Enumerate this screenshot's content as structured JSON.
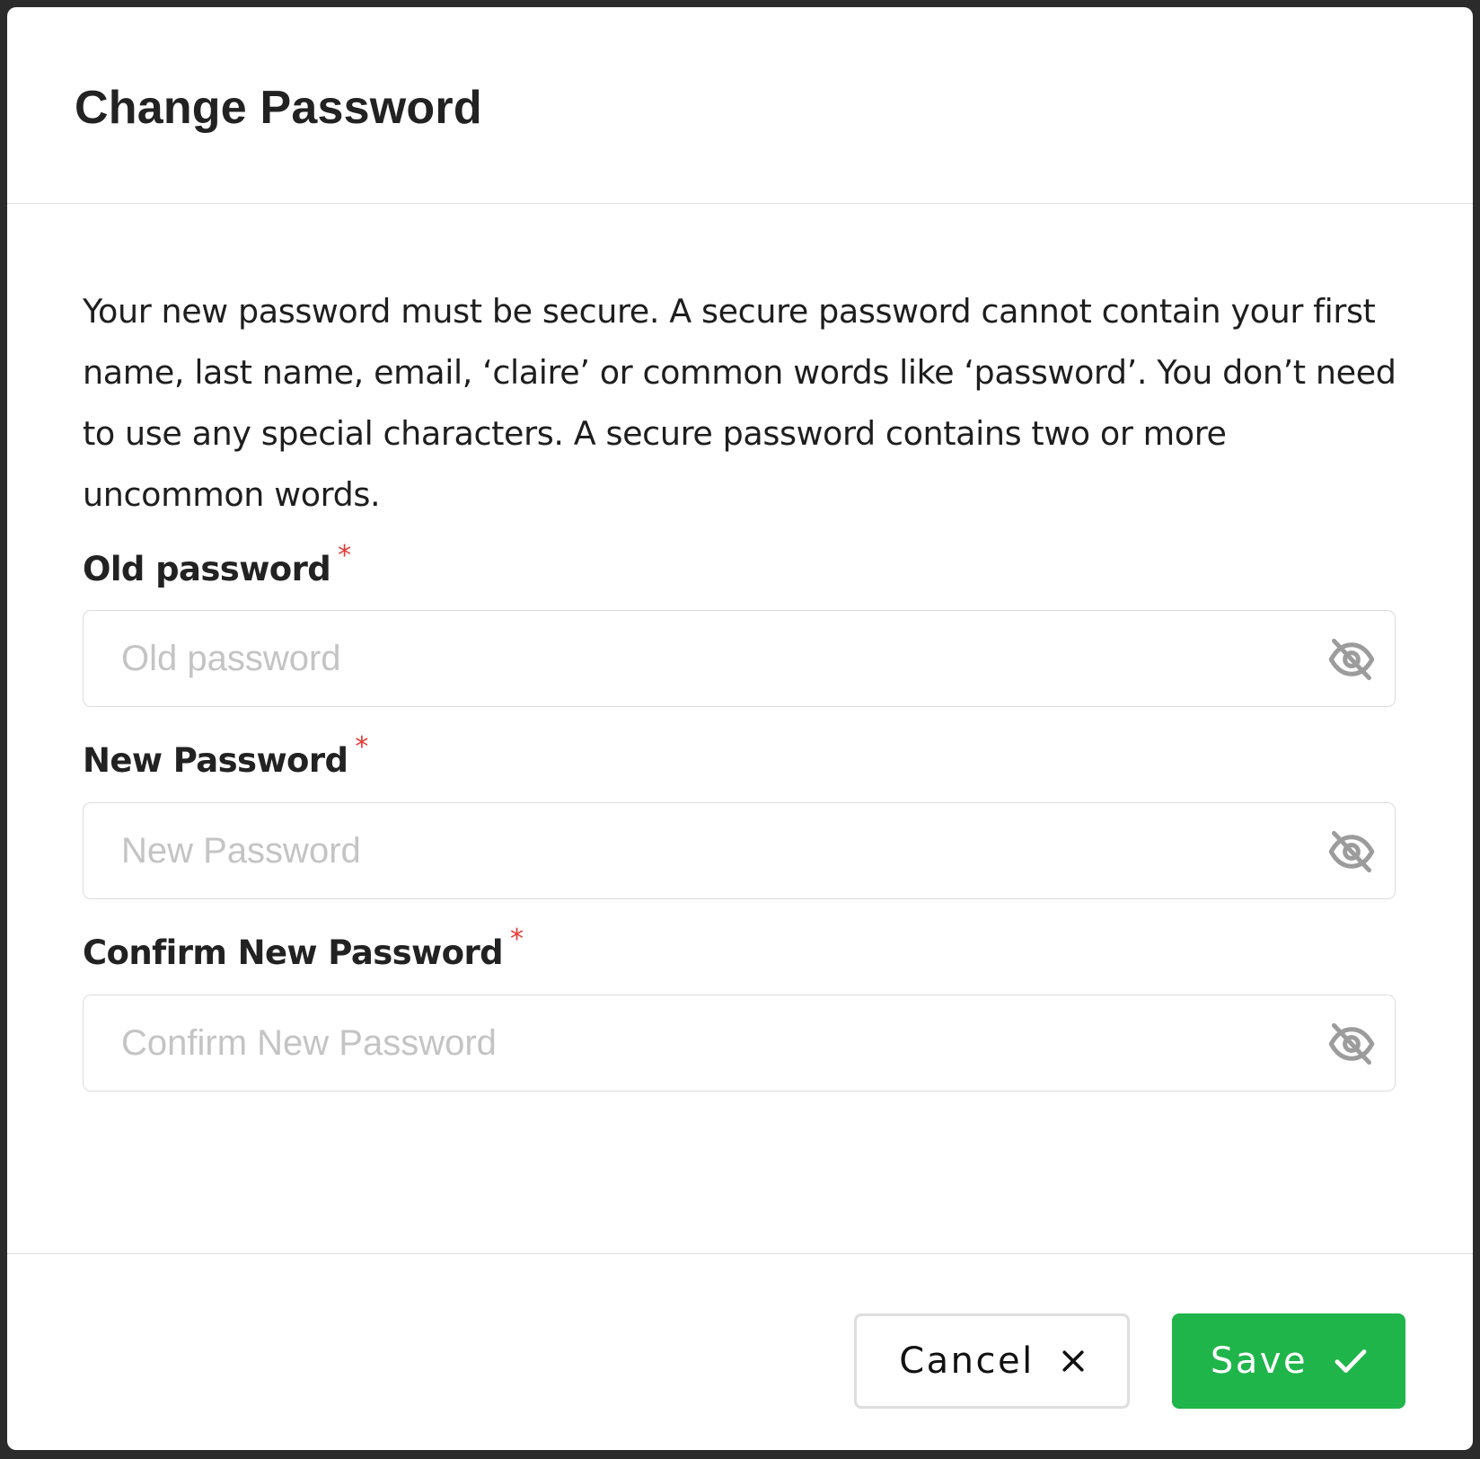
{
  "dialog": {
    "title": "Change Password",
    "description": "Your new password must be secure. A secure password cannot contain your first name, last name, email, ‘claire’ or common words like ‘password’. You don’t need to use any special characters. A secure password contains two or more uncommon words."
  },
  "fields": [
    {
      "label": "Old password",
      "required_mark": "*",
      "placeholder": "Old password",
      "value": "",
      "toggle_icon": "eye-off-icon"
    },
    {
      "label": "New Password",
      "required_mark": "*",
      "placeholder": "New Password",
      "value": "",
      "toggle_icon": "eye-off-icon"
    },
    {
      "label": "Confirm New Password",
      "required_mark": "*",
      "placeholder": "Confirm New Password",
      "value": "",
      "toggle_icon": "eye-off-icon"
    }
  ],
  "footer": {
    "cancel_label": "Cancel",
    "cancel_icon": "close-icon",
    "save_label": "Save",
    "save_icon": "check-icon"
  },
  "colors": {
    "primary": "#20b54a",
    "required": "#e53935",
    "placeholder": "#c4c4c4",
    "border": "#dcdcdc",
    "backdrop": "#2b2b2b"
  }
}
